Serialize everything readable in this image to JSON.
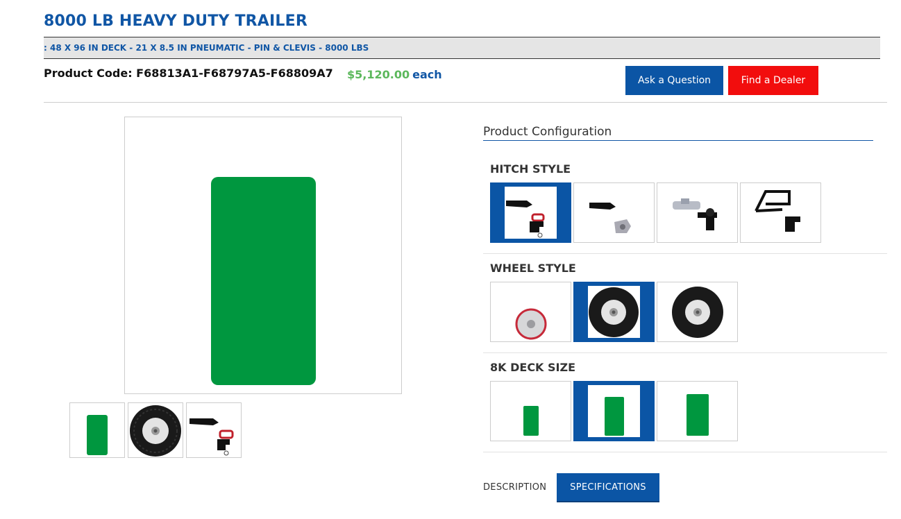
{
  "product": {
    "title": "8000 LB HEAVY DUTY TRAILER",
    "subtitle": ": 48 X 96 IN DECK - 21 X 8.5 IN PNEUMATIC - PIN & CLEVIS - 8000 LBS",
    "code_label": "Product Code: F68813A1-F68797A5-F68809A7",
    "price": "$5,120.00",
    "price_unit": "each"
  },
  "actions": {
    "ask": "Ask a Question",
    "dealer": "Find a Dealer"
  },
  "colors": {
    "brand_blue": "#0b55a5",
    "dealer_red": "#f20d0d",
    "deck_green": "#00973f",
    "price_green": "#5cb85c"
  },
  "gallery": {
    "main_image": "deck-green-panel",
    "thumbnails": [
      "deck-green-panel",
      "pneumatic-wheel",
      "pin-and-clevis-hitch"
    ]
  },
  "configuration": {
    "heading": "Product Configuration",
    "groups": [
      {
        "label": "HITCH STYLE",
        "options": [
          "pin-and-clevis-hitch",
          "clevis-and-lunette-hitch",
          "ball-coupler-hitch",
          "frame-hitch"
        ],
        "selected_index": 0
      },
      {
        "label": "WHEEL STYLE",
        "options": [
          "solid-poly-wheel",
          "pneumatic-wheel-21",
          "pneumatic-wheel-large"
        ],
        "selected_index": 1
      },
      {
        "label": "8K DECK SIZE",
        "options": [
          "small-deck",
          "medium-deck",
          "large-deck"
        ],
        "selected_index": 1
      }
    ]
  },
  "tabs": {
    "description": "DESCRIPTION",
    "specifications": "SPECIFICATIONS",
    "active": "specifications"
  }
}
